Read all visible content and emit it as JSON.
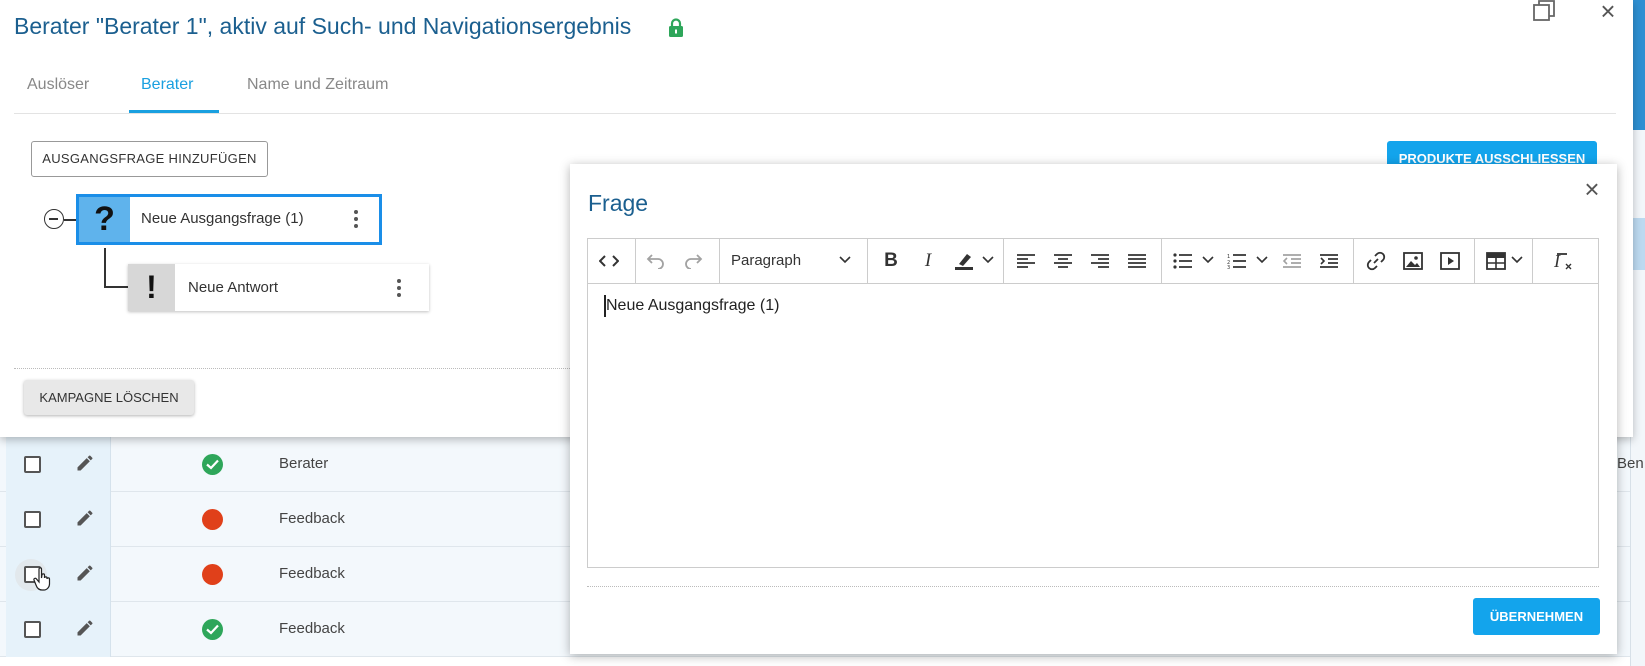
{
  "dialog": {
    "title": "Berater \"Berater 1\", aktiv auf Such- und Navigationsergebnis",
    "tabs": [
      {
        "label": "Auslöser"
      },
      {
        "label": "Berater"
      },
      {
        "label": "Name und Zeitraum"
      }
    ],
    "active_tab": "Berater",
    "add_question_label": "AUSGANGSFRAGE HINZUFÜGEN",
    "exclude_products_label": "PRODUKTE AUSSCHLIESSEN",
    "delete_campaign_label": "KAMPAGNE LÖSCHEN",
    "tree": {
      "question": {
        "icon": "?",
        "label": "Neue Ausgangsfrage (1)"
      },
      "answer": {
        "icon": "!",
        "label": "Neue Antwort"
      }
    }
  },
  "frage": {
    "title": "Frage",
    "block_format": "Paragraph",
    "content": "Neue Ausgangsfrage (1)",
    "apply_label": "ÜBERNEHMEN",
    "toolbar_icons": [
      "source-code-icon",
      "undo-icon",
      "redo-icon",
      "bold-icon",
      "italic-icon",
      "highlight-icon",
      "align-left-icon",
      "align-center-icon",
      "align-right-icon",
      "align-justify-icon",
      "bullet-list-icon",
      "numbered-list-icon",
      "outdent-icon",
      "indent-icon",
      "link-icon",
      "image-icon",
      "media-icon",
      "table-icon",
      "clear-format-icon"
    ]
  },
  "table": {
    "rows": [
      {
        "status": "ok",
        "label": "Berater",
        "tail": "Ben"
      },
      {
        "status": "err",
        "label": "Feedback",
        "tail": ""
      },
      {
        "status": "err",
        "label": "Feedback",
        "tail": ""
      },
      {
        "status": "ok",
        "label": "Feedback",
        "tail": ""
      }
    ]
  },
  "colors": {
    "accent": "#13a4ec",
    "title": "#1b5f8f",
    "status_ok": "#2ea65a",
    "status_err": "#e0401a"
  }
}
